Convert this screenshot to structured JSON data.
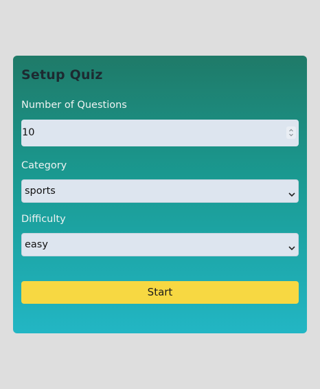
{
  "form": {
    "title": "Setup Quiz",
    "questions_label": "Number of Questions",
    "questions_value": "10",
    "category_label": "Category",
    "category_value": "sports",
    "difficulty_label": "Difficulty",
    "difficulty_value": "easy",
    "start_label": "Start"
  },
  "icons": {
    "spinner": "up-down-spinner-icon",
    "dropdown": "chevron-down-icon"
  },
  "colors": {
    "page_bg": "#dedede",
    "card_gradient_top": "#1f7a68",
    "card_gradient_bottom": "#22b6c4",
    "field_bg": "#dde5ef",
    "button_bg": "#f7d842"
  }
}
